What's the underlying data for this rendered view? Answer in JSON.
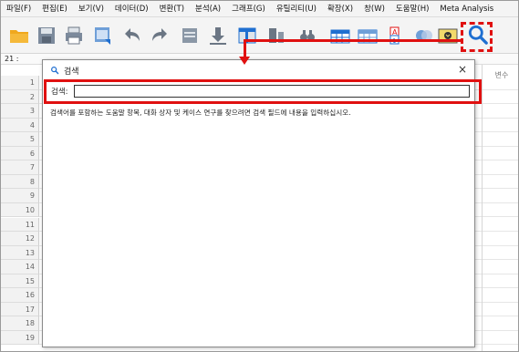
{
  "menubar": {
    "items": [
      "파일(F)",
      "편집(E)",
      "보기(V)",
      "데이터(D)",
      "변환(T)",
      "분석(A)",
      "그래프(G)",
      "유틸리티(U)",
      "확장(X)",
      "창(W)",
      "도움말(H)",
      "Meta Analysis"
    ]
  },
  "toolbar": {
    "icons": [
      "open-folder-icon",
      "save-icon",
      "print-icon",
      "recall-dialog-icon",
      "undo-icon",
      "redo-icon",
      "go-to-case-icon",
      "go-to-variable-icon",
      "variables-icon",
      "run-descriptive-icon",
      "find-icon",
      "insert-cases-icon",
      "insert-variable-icon",
      "split-file-icon",
      "select-cases-icon",
      "value-labels-icon",
      "use-sets-icon",
      "search-icon"
    ]
  },
  "grid": {
    "cell_reference": "21 :",
    "right_column_label": "변수",
    "row_numbers": [
      "1",
      "2",
      "3",
      "4",
      "5",
      "6",
      "7",
      "8",
      "9",
      "10",
      "11",
      "12",
      "13",
      "14",
      "15",
      "16",
      "17",
      "18",
      "19"
    ]
  },
  "dialog": {
    "title": "검색",
    "close_label": "×",
    "search_label": "검색:",
    "search_value": "",
    "help_text": "검색어를 포함하는 도움말 항목, 대화 상자 및 케이스 연구를 찾으려면 검색 필드에 내용을 입력하십시오."
  },
  "colors": {
    "highlight": "#e01010",
    "menubar_bg": "#f4f4f4",
    "accent_blue": "#1f6fd1"
  }
}
